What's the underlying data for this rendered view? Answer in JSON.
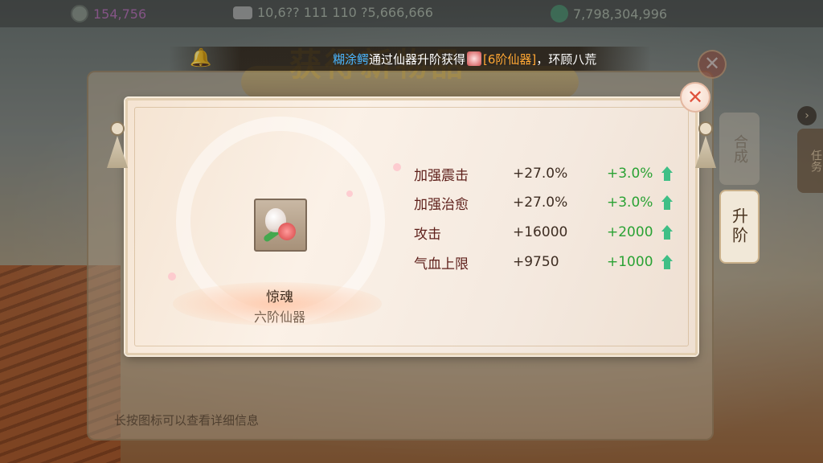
{
  "currency": {
    "gold": "154,756",
    "silver": "10,6?? 111 110 ?5,666,666",
    "jade": "7,798,304,996"
  },
  "announcement": {
    "player_name": "糊涂鳄",
    "text_middle": "通过仙器升阶获得",
    "item_text": "[6阶仙器]",
    "text_end": "，环顾八荒"
  },
  "back_panel": {
    "title": "获得新物品",
    "hint": "长按图标可以查看详细信息"
  },
  "side_tabs": {
    "task": "任务",
    "upgrade": "升阶",
    "faded": "合成"
  },
  "popup": {
    "item_name": "惊魂",
    "item_grade": "六阶仙器",
    "stats": [
      {
        "name": "加强震击",
        "value": "+27.0%",
        "increase": "+3.0%"
      },
      {
        "name": "加强治愈",
        "value": "+27.0%",
        "increase": "+3.0%"
      },
      {
        "name": "攻击",
        "value": "+16000",
        "increase": "+2000"
      },
      {
        "name": "气血上限",
        "value": "+9750",
        "increase": "+1000"
      }
    ]
  },
  "colors": {
    "stat_name": "#5e1f1a",
    "increase": "#2aa234",
    "up_arrow": "#3fbf86",
    "player_name": "#4ab6ff",
    "item_highlight": "#ffa733",
    "close": "#e0533e"
  }
}
